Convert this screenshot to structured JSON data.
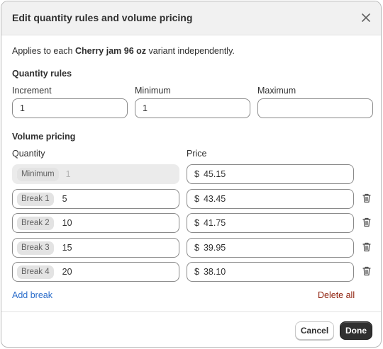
{
  "modal": {
    "title": "Edit quantity rules and volume pricing",
    "applies_prefix": "Applies to each",
    "product_name": "Cherry jam 96 oz",
    "applies_suffix": "variant independently."
  },
  "quantity_rules": {
    "title": "Quantity rules",
    "increment": {
      "label": "Increment",
      "value": "1"
    },
    "minimum": {
      "label": "Minimum",
      "value": "1"
    },
    "maximum": {
      "label": "Maximum",
      "value": ""
    }
  },
  "volume_pricing": {
    "title": "Volume pricing",
    "quantity_header": "Quantity",
    "price_header": "Price",
    "currency": "$",
    "minimum_row": {
      "chip": "Minimum",
      "quantity": "1",
      "price": "45.15"
    },
    "breaks": [
      {
        "chip": "Break 1",
        "quantity": "5",
        "price": "43.45"
      },
      {
        "chip": "Break 2",
        "quantity": "10",
        "price": "41.75"
      },
      {
        "chip": "Break 3",
        "quantity": "15",
        "price": "39.95"
      },
      {
        "chip": "Break 4",
        "quantity": "20",
        "price": "38.10"
      }
    ],
    "add_break": "Add break",
    "delete_all": "Delete all"
  },
  "footer": {
    "cancel": "Cancel",
    "done": "Done"
  },
  "colors": {
    "link": "#2c6ecb",
    "destructive": "#8e1f0b",
    "primary": "#303030"
  },
  "icons": {
    "close": "close-icon",
    "delete": "trash-icon"
  }
}
